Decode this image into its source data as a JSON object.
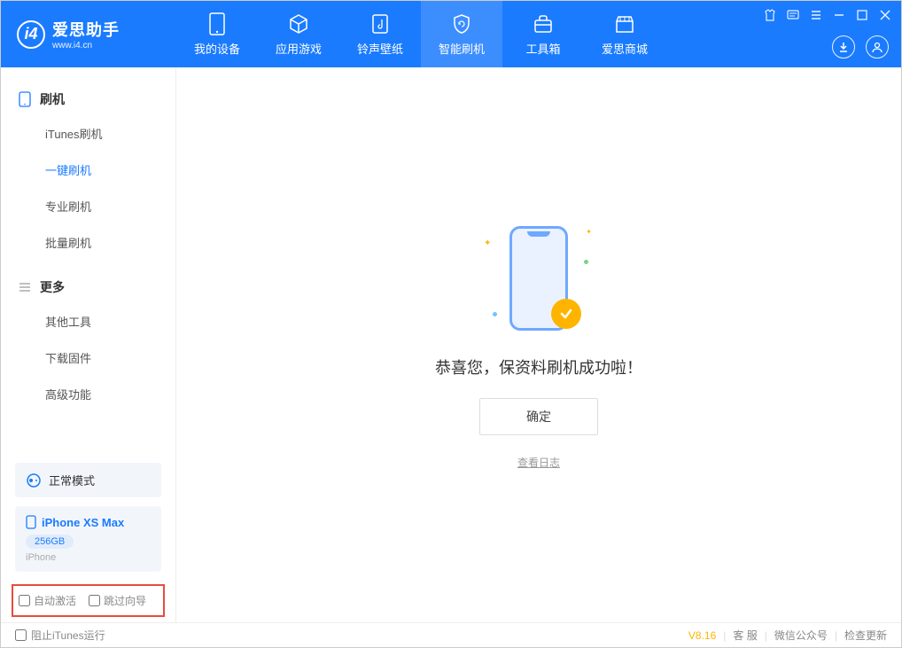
{
  "header": {
    "logo_title": "爱思助手",
    "logo_sub": "www.i4.cn",
    "tabs": {
      "device": "我的设备",
      "apps": "应用游戏",
      "ringtones": "铃声壁纸",
      "flash": "智能刷机",
      "toolbox": "工具箱",
      "store": "爱思商城"
    }
  },
  "sidebar": {
    "group_flash": "刷机",
    "items_flash": {
      "itunes": "iTunes刷机",
      "onekey": "一键刷机",
      "pro": "专业刷机",
      "batch": "批量刷机"
    },
    "group_more": "更多",
    "items_more": {
      "other": "其他工具",
      "firmware": "下载固件",
      "advanced": "高级功能"
    },
    "mode_label": "正常模式",
    "device_name": "iPhone XS Max",
    "device_capacity": "256GB",
    "device_type": "iPhone",
    "opt_auto_activate": "自动激活",
    "opt_skip_guide": "跳过向导"
  },
  "main": {
    "success_text": "恭喜您，保资料刷机成功啦！",
    "ok_button": "确定",
    "view_log": "查看日志"
  },
  "footer": {
    "block_itunes": "阻止iTunes运行",
    "version": "V8.16",
    "support": "客 服",
    "wechat": "微信公众号",
    "check_update": "检查更新"
  }
}
